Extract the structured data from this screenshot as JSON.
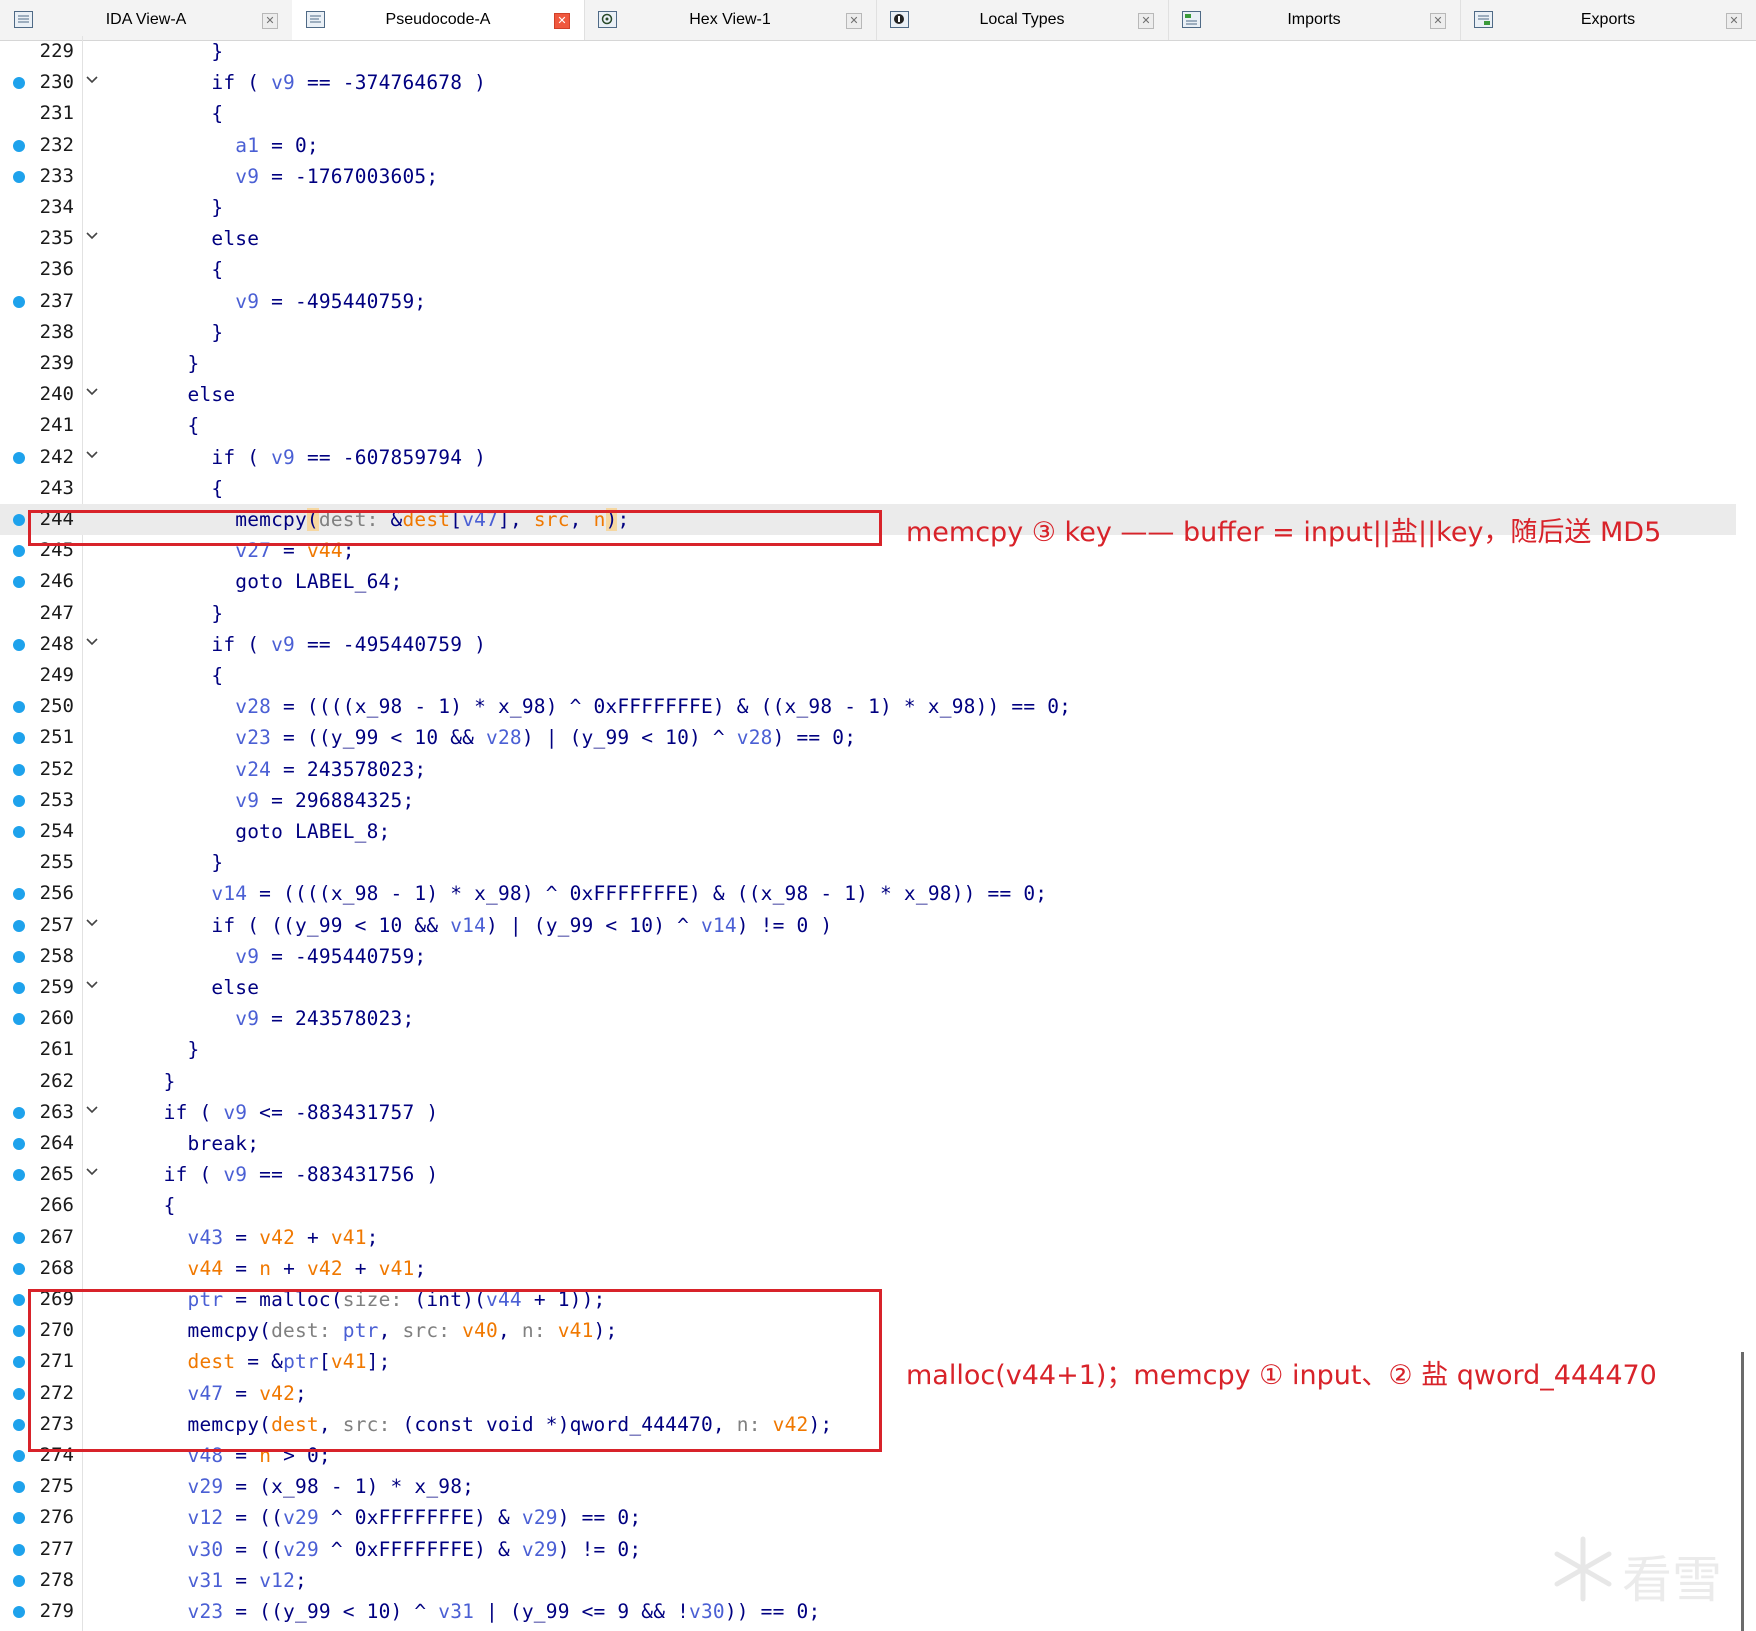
{
  "tabs": [
    {
      "label": "IDA View-A",
      "icon": "ida-view-icon",
      "close": "✕",
      "active": false
    },
    {
      "label": "Pseudocode-A",
      "icon": "pseudocode-icon",
      "close": "✕",
      "active": true
    },
    {
      "label": "Hex View-1",
      "icon": "hex-view-icon",
      "close": "✕",
      "active": false
    },
    {
      "label": "Local Types",
      "icon": "local-types-icon",
      "close": "✕",
      "active": false
    },
    {
      "label": "Imports",
      "icon": "imports-icon",
      "close": "✕",
      "active": false
    },
    {
      "label": "Exports",
      "icon": "exports-icon",
      "close": "✕",
      "active": false
    }
  ],
  "code_lines": [
    {
      "n": "229",
      "dot": false,
      "fold": false,
      "toks": [
        [
          "p",
          "          }"
        ]
      ]
    },
    {
      "n": "230",
      "dot": true,
      "fold": true,
      "toks": [
        [
          "p",
          "          if ( "
        ],
        [
          "v",
          "v9"
        ],
        [
          "p",
          " == -374764678 )"
        ]
      ]
    },
    {
      "n": "231",
      "dot": false,
      "fold": false,
      "toks": [
        [
          "p",
          "          {"
        ]
      ]
    },
    {
      "n": "232",
      "dot": true,
      "fold": false,
      "toks": [
        [
          "p",
          "            "
        ],
        [
          "v",
          "a1"
        ],
        [
          "p",
          " = 0;"
        ]
      ]
    },
    {
      "n": "233",
      "dot": true,
      "fold": false,
      "toks": [
        [
          "p",
          "            "
        ],
        [
          "v",
          "v9"
        ],
        [
          "p",
          " = -1767003605;"
        ]
      ]
    },
    {
      "n": "234",
      "dot": false,
      "fold": false,
      "toks": [
        [
          "p",
          "          }"
        ]
      ]
    },
    {
      "n": "235",
      "dot": false,
      "fold": true,
      "toks": [
        [
          "p",
          "          else"
        ]
      ]
    },
    {
      "n": "236",
      "dot": false,
      "fold": false,
      "toks": [
        [
          "p",
          "          {"
        ]
      ]
    },
    {
      "n": "237",
      "dot": true,
      "fold": false,
      "toks": [
        [
          "p",
          "            "
        ],
        [
          "v",
          "v9"
        ],
        [
          "p",
          " = -495440759;"
        ]
      ]
    },
    {
      "n": "238",
      "dot": false,
      "fold": false,
      "toks": [
        [
          "p",
          "          }"
        ]
      ]
    },
    {
      "n": "239",
      "dot": false,
      "fold": false,
      "toks": [
        [
          "p",
          "        }"
        ]
      ]
    },
    {
      "n": "240",
      "dot": false,
      "fold": true,
      "toks": [
        [
          "p",
          "        else"
        ]
      ]
    },
    {
      "n": "241",
      "dot": false,
      "fold": false,
      "toks": [
        [
          "p",
          "        {"
        ]
      ]
    },
    {
      "n": "242",
      "dot": true,
      "fold": true,
      "toks": [
        [
          "p",
          "          if ( "
        ],
        [
          "v",
          "v9"
        ],
        [
          "p",
          " == -607859794 )"
        ]
      ]
    },
    {
      "n": "243",
      "dot": false,
      "fold": false,
      "toks": [
        [
          "p",
          "          {"
        ]
      ]
    },
    {
      "n": "244",
      "dot": true,
      "fold": false,
      "hl": true,
      "toks": [
        [
          "p",
          "            memcpy"
        ],
        [
          "h",
          "("
        ],
        [
          "c",
          "dest: "
        ],
        [
          "p",
          "&"
        ],
        [
          "g",
          "dest"
        ],
        [
          "p",
          "["
        ],
        [
          "v",
          "v47"
        ],
        [
          "p",
          "], "
        ],
        [
          "g",
          "src"
        ],
        [
          "p",
          ", "
        ],
        [
          "g",
          "n"
        ],
        [
          "h",
          ")"
        ],
        [
          "p",
          ";"
        ]
      ]
    },
    {
      "n": "245",
      "dot": true,
      "fold": false,
      "toks": [
        [
          "p",
          "            "
        ],
        [
          "v",
          "v27"
        ],
        [
          "p",
          " = "
        ],
        [
          "g",
          "v44"
        ],
        [
          "p",
          ";"
        ]
      ]
    },
    {
      "n": "246",
      "dot": true,
      "fold": false,
      "toks": [
        [
          "p",
          "            goto LABEL_64;"
        ]
      ]
    },
    {
      "n": "247",
      "dot": false,
      "fold": false,
      "toks": [
        [
          "p",
          "          }"
        ]
      ]
    },
    {
      "n": "248",
      "dot": true,
      "fold": true,
      "toks": [
        [
          "p",
          "          if ( "
        ],
        [
          "v",
          "v9"
        ],
        [
          "p",
          " == -495440759 )"
        ]
      ]
    },
    {
      "n": "249",
      "dot": false,
      "fold": false,
      "toks": [
        [
          "p",
          "          {"
        ]
      ]
    },
    {
      "n": "250",
      "dot": true,
      "fold": false,
      "toks": [
        [
          "p",
          "            "
        ],
        [
          "v",
          "v28"
        ],
        [
          "p",
          " = ((((x_98 - 1) * x_98) ^ 0xFFFFFFFE) & ((x_98 - 1) * x_98)) == 0;"
        ]
      ]
    },
    {
      "n": "251",
      "dot": true,
      "fold": false,
      "toks": [
        [
          "p",
          "            "
        ],
        [
          "v",
          "v23"
        ],
        [
          "p",
          " = ((y_99 < 10 && "
        ],
        [
          "v",
          "v28"
        ],
        [
          "p",
          ") | (y_99 < 10) ^ "
        ],
        [
          "v",
          "v28"
        ],
        [
          "p",
          ") == 0;"
        ]
      ]
    },
    {
      "n": "252",
      "dot": true,
      "fold": false,
      "toks": [
        [
          "p",
          "            "
        ],
        [
          "v",
          "v24"
        ],
        [
          "p",
          " = 243578023;"
        ]
      ]
    },
    {
      "n": "253",
      "dot": true,
      "fold": false,
      "toks": [
        [
          "p",
          "            "
        ],
        [
          "v",
          "v9"
        ],
        [
          "p",
          " = 296884325;"
        ]
      ]
    },
    {
      "n": "254",
      "dot": true,
      "fold": false,
      "toks": [
        [
          "p",
          "            goto LABEL_8;"
        ]
      ]
    },
    {
      "n": "255",
      "dot": false,
      "fold": false,
      "toks": [
        [
          "p",
          "          }"
        ]
      ]
    },
    {
      "n": "256",
      "dot": true,
      "fold": false,
      "toks": [
        [
          "p",
          "          "
        ],
        [
          "v",
          "v14"
        ],
        [
          "p",
          " = ((((x_98 - 1) * x_98) ^ 0xFFFFFFFE) & ((x_98 - 1) * x_98)) == 0;"
        ]
      ]
    },
    {
      "n": "257",
      "dot": true,
      "fold": true,
      "toks": [
        [
          "p",
          "          if ( ((y_99 < 10 && "
        ],
        [
          "v",
          "v14"
        ],
        [
          "p",
          ") | (y_99 < 10) ^ "
        ],
        [
          "v",
          "v14"
        ],
        [
          "p",
          ") != 0 )"
        ]
      ]
    },
    {
      "n": "258",
      "dot": true,
      "fold": false,
      "toks": [
        [
          "p",
          "            "
        ],
        [
          "v",
          "v9"
        ],
        [
          "p",
          " = -495440759;"
        ]
      ]
    },
    {
      "n": "259",
      "dot": true,
      "fold": true,
      "toks": [
        [
          "p",
          "          else"
        ]
      ]
    },
    {
      "n": "260",
      "dot": true,
      "fold": false,
      "toks": [
        [
          "p",
          "            "
        ],
        [
          "v",
          "v9"
        ],
        [
          "p",
          " = 243578023;"
        ]
      ]
    },
    {
      "n": "261",
      "dot": false,
      "fold": false,
      "toks": [
        [
          "p",
          "        }"
        ]
      ]
    },
    {
      "n": "262",
      "dot": false,
      "fold": false,
      "toks": [
        [
          "p",
          "      }"
        ]
      ]
    },
    {
      "n": "263",
      "dot": true,
      "fold": true,
      "toks": [
        [
          "p",
          "      if ( "
        ],
        [
          "v",
          "v9"
        ],
        [
          "p",
          " <= -883431757 )"
        ]
      ]
    },
    {
      "n": "264",
      "dot": true,
      "fold": false,
      "toks": [
        [
          "p",
          "        break;"
        ]
      ]
    },
    {
      "n": "265",
      "dot": true,
      "fold": true,
      "toks": [
        [
          "p",
          "      if ( "
        ],
        [
          "v",
          "v9"
        ],
        [
          "p",
          " == -883431756 )"
        ]
      ]
    },
    {
      "n": "266",
      "dot": false,
      "fold": false,
      "toks": [
        [
          "p",
          "      {"
        ]
      ]
    },
    {
      "n": "267",
      "dot": true,
      "fold": false,
      "toks": [
        [
          "p",
          "        "
        ],
        [
          "v",
          "v43"
        ],
        [
          "p",
          " = "
        ],
        [
          "g",
          "v42"
        ],
        [
          "p",
          " + "
        ],
        [
          "g",
          "v41"
        ],
        [
          "p",
          ";"
        ]
      ]
    },
    {
      "n": "268",
      "dot": true,
      "fold": false,
      "toks": [
        [
          "p",
          "        "
        ],
        [
          "g",
          "v44"
        ],
        [
          "p",
          " = "
        ],
        [
          "g",
          "n"
        ],
        [
          "p",
          " + "
        ],
        [
          "g",
          "v42"
        ],
        [
          "p",
          " + "
        ],
        [
          "g",
          "v41"
        ],
        [
          "p",
          ";"
        ]
      ]
    },
    {
      "n": "269",
      "dot": true,
      "fold": false,
      "toks": [
        [
          "p",
          "        "
        ],
        [
          "v",
          "ptr"
        ],
        [
          "p",
          " = malloc("
        ],
        [
          "c",
          "size: "
        ],
        [
          "p",
          "(int)("
        ],
        [
          "v",
          "v44"
        ],
        [
          "p",
          " + 1));"
        ]
      ]
    },
    {
      "n": "270",
      "dot": true,
      "fold": false,
      "toks": [
        [
          "p",
          "        memcpy("
        ],
        [
          "c",
          "dest: "
        ],
        [
          "v",
          "ptr"
        ],
        [
          "p",
          ", "
        ],
        [
          "c",
          "src: "
        ],
        [
          "g",
          "v40"
        ],
        [
          "p",
          ", "
        ],
        [
          "c",
          "n: "
        ],
        [
          "g",
          "v41"
        ],
        [
          "p",
          ");"
        ]
      ]
    },
    {
      "n": "271",
      "dot": true,
      "fold": false,
      "toks": [
        [
          "p",
          "        "
        ],
        [
          "g",
          "dest"
        ],
        [
          "p",
          " = &"
        ],
        [
          "v",
          "ptr"
        ],
        [
          "p",
          "["
        ],
        [
          "g",
          "v41"
        ],
        [
          "p",
          "];"
        ]
      ]
    },
    {
      "n": "272",
      "dot": true,
      "fold": false,
      "toks": [
        [
          "p",
          "        "
        ],
        [
          "v",
          "v47"
        ],
        [
          "p",
          " = "
        ],
        [
          "g",
          "v42"
        ],
        [
          "p",
          ";"
        ]
      ]
    },
    {
      "n": "273",
      "dot": true,
      "fold": false,
      "toks": [
        [
          "p",
          "        memcpy("
        ],
        [
          "g",
          "dest"
        ],
        [
          "p",
          ", "
        ],
        [
          "c",
          "src: "
        ],
        [
          "p",
          "(const void *)qword_444470, "
        ],
        [
          "c",
          "n: "
        ],
        [
          "g",
          "v42"
        ],
        [
          "p",
          ");"
        ]
      ]
    },
    {
      "n": "274",
      "dot": true,
      "fold": false,
      "toks": [
        [
          "p",
          "        "
        ],
        [
          "v",
          "v48"
        ],
        [
          "p",
          " = "
        ],
        [
          "g",
          "n"
        ],
        [
          "p",
          " > 0;"
        ]
      ]
    },
    {
      "n": "275",
      "dot": true,
      "fold": false,
      "toks": [
        [
          "p",
          "        "
        ],
        [
          "v",
          "v29"
        ],
        [
          "p",
          " = (x_98 - 1) * x_98;"
        ]
      ]
    },
    {
      "n": "276",
      "dot": true,
      "fold": false,
      "toks": [
        [
          "p",
          "        "
        ],
        [
          "v",
          "v12"
        ],
        [
          "p",
          " = (("
        ],
        [
          "v",
          "v29"
        ],
        [
          "p",
          " ^ 0xFFFFFFFE) & "
        ],
        [
          "v",
          "v29"
        ],
        [
          "p",
          ") == 0;"
        ]
      ]
    },
    {
      "n": "277",
      "dot": true,
      "fold": false,
      "toks": [
        [
          "p",
          "        "
        ],
        [
          "v",
          "v30"
        ],
        [
          "p",
          " = (("
        ],
        [
          "v",
          "v29"
        ],
        [
          "p",
          " ^ 0xFFFFFFFE) & "
        ],
        [
          "v",
          "v29"
        ],
        [
          "p",
          ") != 0;"
        ]
      ]
    },
    {
      "n": "278",
      "dot": true,
      "fold": false,
      "toks": [
        [
          "p",
          "        "
        ],
        [
          "v",
          "v31"
        ],
        [
          "p",
          " = "
        ],
        [
          "v",
          "v12"
        ],
        [
          "p",
          ";"
        ]
      ]
    },
    {
      "n": "279",
      "dot": true,
      "fold": false,
      "toks": [
        [
          "p",
          "        "
        ],
        [
          "v",
          "v23"
        ],
        [
          "p",
          " = ((y_99 < 10) ^ "
        ],
        [
          "v",
          "v31"
        ],
        [
          "p",
          " | (y_99 <= 9 && !"
        ],
        [
          "v",
          "v30"
        ],
        [
          "p",
          ")) == 0;"
        ]
      ]
    }
  ],
  "annotations": {
    "top_note": "memcpy ③ key —— buffer = input||盐||key，随后送 MD5",
    "bottom_note": "malloc(v44+1)；memcpy ① input、② 盐 qword_444470"
  },
  "watermark": {
    "text": "看雪",
    "icon": "snowflake-icon"
  },
  "colors": {
    "keyword": "#000080",
    "local_var": "#4a5fd4",
    "global_var": "#f07800",
    "hint": "#808080",
    "breakpoint_dot": "#1ea2ec",
    "annotation_red": "#d8232a",
    "highlight_row": "#ebebeb"
  }
}
